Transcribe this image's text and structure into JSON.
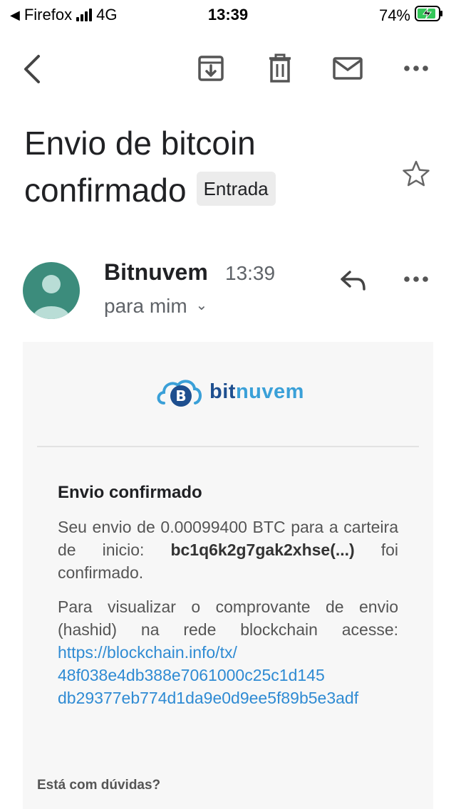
{
  "status_bar": {
    "back_app": "Firefox",
    "network": "4G",
    "time": "13:39",
    "battery": "74%"
  },
  "toolbar": {
    "icons": [
      "back-icon",
      "archive-icon",
      "trash-icon",
      "mail-icon",
      "more-icon"
    ]
  },
  "email": {
    "subject": "Envio de bitcoin confirmado",
    "label": "Entrada",
    "sender": "Bitnuvem",
    "time": "13:39",
    "recipient": "para mim",
    "logo": {
      "part1": "bit",
      "part2": "nuvem"
    },
    "body": {
      "title": "Envio confirmado",
      "p1_text": "Seu envio de 0.00099400 BTC para a carteira de inicio:",
      "p1_address": "bc1q6k2g7gak2xhse(...)",
      "p1_end": "foi confirmado.",
      "p2_text": "Para visualizar o comprovante de envio (hashid) na rede blockchain acesse:",
      "link_lines": [
        "https://blockchain.info/tx/",
        "48f038e4db388e7061000c25c1d145",
        "db29377eb774d1da9e0d9ee5f89b5e3adf"
      ],
      "question": "Está com dúvidas?"
    }
  },
  "colors": {
    "avatar": "#3c8c7c",
    "link": "#2f8bd3",
    "logo_dark": "#1e4f8f",
    "logo_light": "#3aa0d8",
    "battery_charge": "#34c759"
  }
}
